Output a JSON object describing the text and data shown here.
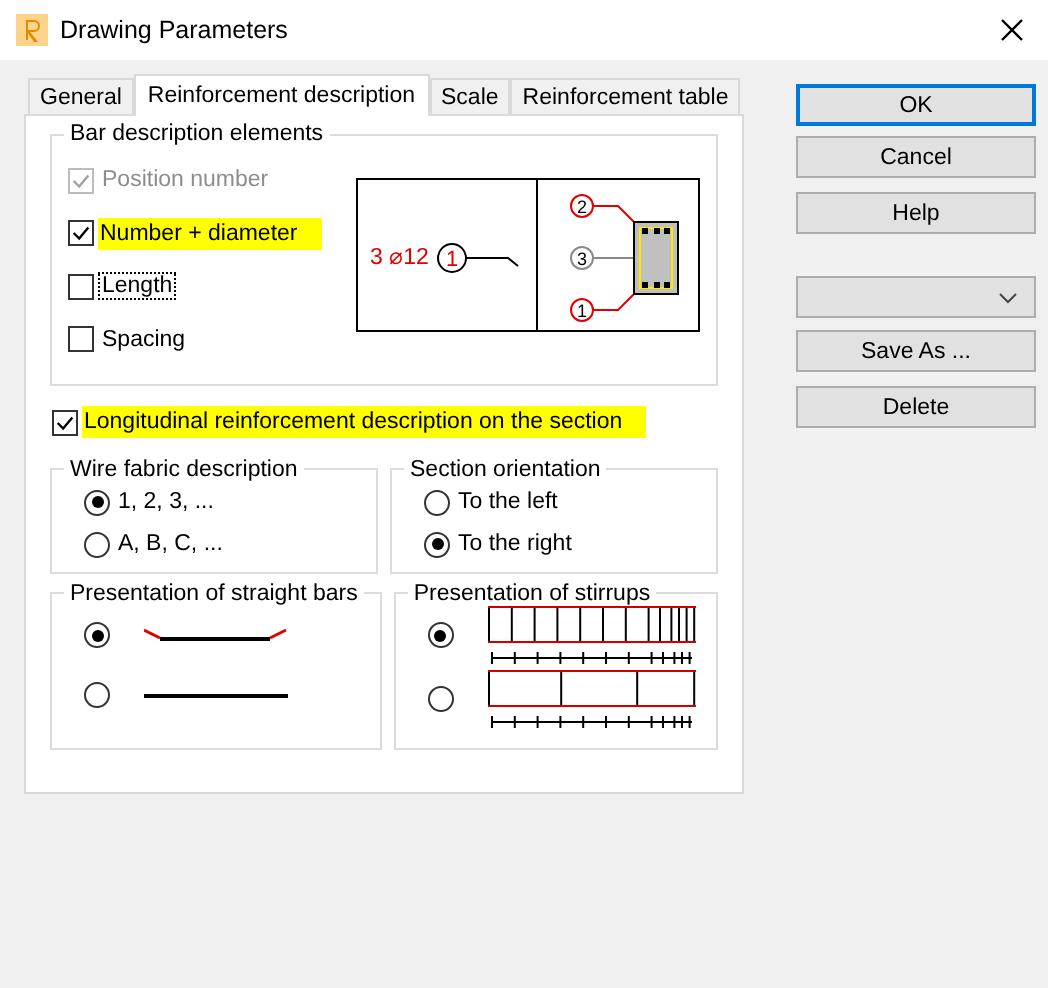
{
  "window": {
    "title": "Drawing Parameters"
  },
  "tabs": [
    {
      "label": "General",
      "selected": false
    },
    {
      "label": "Reinforcement description",
      "selected": true
    },
    {
      "label": "Scale",
      "selected": false
    },
    {
      "label": "Reinforcement table",
      "selected": false
    }
  ],
  "bar_description": {
    "title": "Bar description elements",
    "options": [
      {
        "label": "Position number",
        "checked": true,
        "disabled": true,
        "highlighted": false,
        "focused": false
      },
      {
        "label": "Number + diameter",
        "checked": true,
        "disabled": false,
        "highlighted": true,
        "focused": false
      },
      {
        "label": "Length",
        "checked": false,
        "disabled": false,
        "highlighted": false,
        "focused": true
      },
      {
        "label": "Spacing",
        "checked": false,
        "disabled": false,
        "highlighted": false,
        "focused": false
      }
    ],
    "diagram": {
      "callout": "3 ⌀12",
      "marks": [
        "1",
        "2",
        "3",
        "1"
      ]
    }
  },
  "longitudinal": {
    "label": "Longitudinal reinforcement description on the section",
    "checked": true,
    "highlighted": true
  },
  "wire_fabric": {
    "title": "Wire fabric description",
    "options": [
      {
        "label": "1, 2, 3, ...",
        "selected": true
      },
      {
        "label": "A, B, C, ...",
        "selected": false
      }
    ]
  },
  "section_orientation": {
    "title": "Section orientation",
    "options": [
      {
        "label": "To the left",
        "selected": false
      },
      {
        "label": "To the right",
        "selected": true
      }
    ]
  },
  "straight_bars": {
    "title": "Presentation of straight bars",
    "options": [
      {
        "kind": "hooked",
        "selected": true
      },
      {
        "kind": "plain",
        "selected": false
      }
    ]
  },
  "stirrups": {
    "title": "Presentation of stirrups",
    "options": [
      {
        "kind": "dense",
        "selected": true
      },
      {
        "kind": "sparse",
        "selected": false
      }
    ]
  },
  "buttons": [
    {
      "label": "OK",
      "default": true
    },
    {
      "label": "Cancel",
      "default": false
    },
    {
      "label": "Help",
      "default": false
    }
  ],
  "file_buttons": [
    "Save As ...",
    "Delete"
  ]
}
